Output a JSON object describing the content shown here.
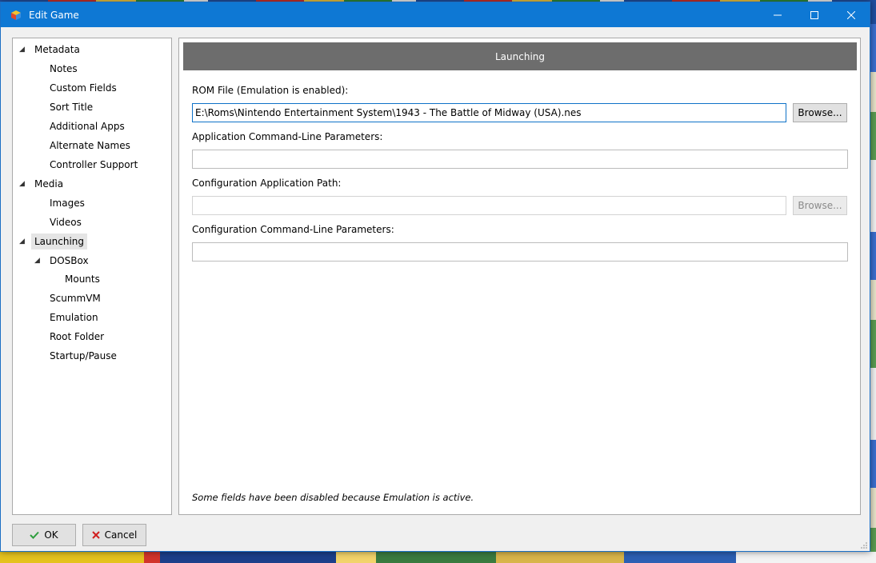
{
  "window": {
    "title": "Edit Game"
  },
  "tree": {
    "items": [
      {
        "label": "Metadata",
        "level": 0,
        "expanded": true
      },
      {
        "label": "Notes",
        "level": 1
      },
      {
        "label": "Custom Fields",
        "level": 1
      },
      {
        "label": "Sort Title",
        "level": 1
      },
      {
        "label": "Additional Apps",
        "level": 1
      },
      {
        "label": "Alternate Names",
        "level": 1
      },
      {
        "label": "Controller Support",
        "level": 1
      },
      {
        "label": "Media",
        "level": 0,
        "expanded": true
      },
      {
        "label": "Images",
        "level": 1
      },
      {
        "label": "Videos",
        "level": 1
      },
      {
        "label": "Launching",
        "level": 0,
        "expanded": true,
        "selected": true
      },
      {
        "label": "DOSBox",
        "level": 1,
        "expanded": true
      },
      {
        "label": "Mounts",
        "level": 2
      },
      {
        "label": "ScummVM",
        "level": 1
      },
      {
        "label": "Emulation",
        "level": 1
      },
      {
        "label": "Root Folder",
        "level": 1
      },
      {
        "label": "Startup/Pause",
        "level": 1
      }
    ]
  },
  "content": {
    "header": "Launching",
    "rom_label": "ROM File (Emulation is enabled):",
    "rom_value": "E:\\Roms\\Nintendo Entertainment System\\1943 - The Battle of Midway (USA).nes",
    "browse_label": "Browse...",
    "app_params_label": "Application Command-Line Parameters:",
    "app_params_value": "",
    "config_path_label": "Configuration Application Path:",
    "config_path_value": "",
    "config_browse_label": "Browse...",
    "config_params_label": "Configuration Command-Line Parameters:",
    "config_params_value": "",
    "note": "Some fields have been disabled because Emulation is active."
  },
  "buttons": {
    "ok": "OK",
    "cancel": "Cancel"
  },
  "colors": {
    "titlebar": "#0e78d4",
    "header": "#6d6d6d",
    "ok_icon": "#2e9e3e",
    "cancel_icon": "#d02020"
  }
}
